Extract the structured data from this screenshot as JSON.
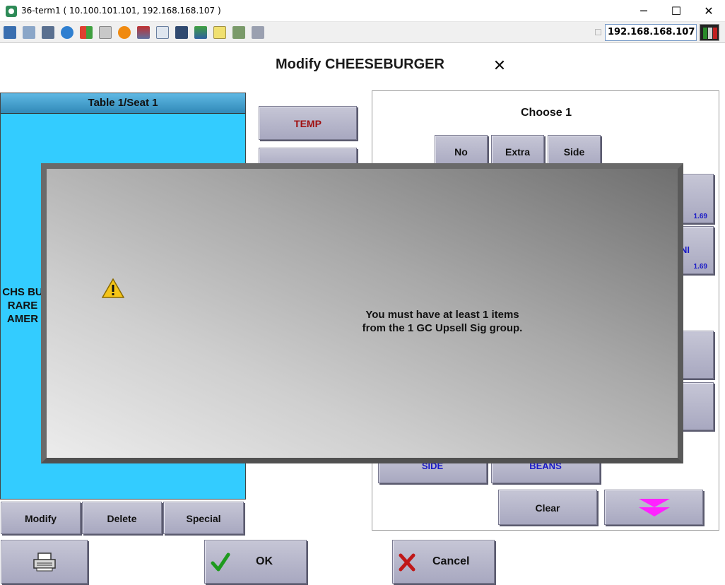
{
  "window": {
    "title": "36-term1 ( 10.100.101.101, 192.168.168.107 )",
    "minimize": "─",
    "maximize": "☐",
    "close": "✕"
  },
  "toolbar": {
    "ip_value": "192.168.168.107",
    "icons": [
      "monitor-icon",
      "copy-icon",
      "tools-icon",
      "refresh-icon",
      "windows-icon",
      "keyboard-icon",
      "alert-icon",
      "network-icon",
      "fullscreen-icon",
      "screen-icon",
      "download-icon",
      "notes-icon",
      "picture-icon",
      "chat-icon"
    ]
  },
  "screen": {
    "title": "Modify CHEESEBURGER",
    "close": "✕"
  },
  "seat_panel": {
    "header": "Table 1/Seat 1",
    "lines": [
      "CHS BU",
      "RARE",
      "AMER"
    ]
  },
  "middle_buttons": {
    "temp": "TEMP"
  },
  "choose_panel": {
    "title": "Choose 1",
    "mode_buttons": [
      "No",
      "Extra",
      "Side"
    ],
    "item1_price": "1.69",
    "item2_label": "NI",
    "item2_price": "1.69",
    "side_label": "SIDE",
    "beans_label": "BEANS",
    "clear_label": "Clear"
  },
  "bottom_actions": {
    "modify": "Modify",
    "delete": "Delete",
    "special": "Special"
  },
  "footer": {
    "ok": "OK",
    "cancel": "Cancel"
  },
  "dialog": {
    "line1": "You must have at least 1 items",
    "line2": "from the 1 GC Upsell Sig group."
  },
  "colors": {
    "seat_panel": "#33ccff",
    "button_face": "#b8b8cc",
    "temp_text": "#a01010",
    "price_text": "#1a1ac8",
    "scroll_arrow": "#ff22ff"
  }
}
